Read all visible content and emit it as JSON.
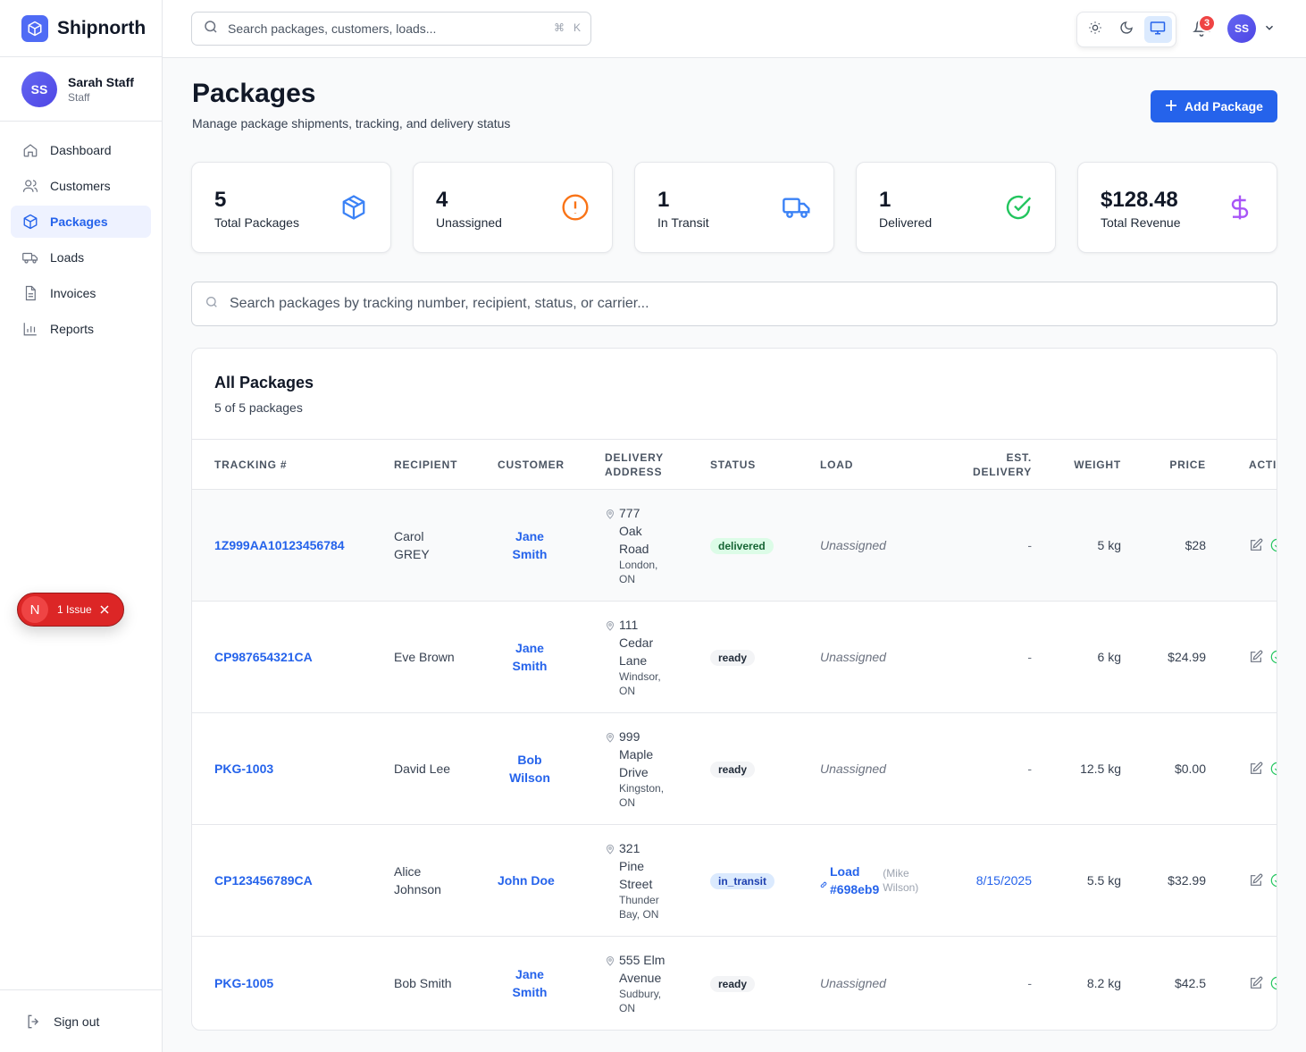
{
  "brand": {
    "name": "Shipnorth"
  },
  "user": {
    "initials": "SS",
    "name": "Sarah Staff",
    "role": "Staff"
  },
  "nav": [
    {
      "label": "Dashboard",
      "icon": "home-icon"
    },
    {
      "label": "Customers",
      "icon": "users-icon"
    },
    {
      "label": "Packages",
      "icon": "package-icon",
      "active": true
    },
    {
      "label": "Loads",
      "icon": "truck-icon"
    },
    {
      "label": "Invoices",
      "icon": "file-icon"
    },
    {
      "label": "Reports",
      "icon": "bar-chart-icon"
    }
  ],
  "signout_label": "Sign out",
  "issue": {
    "letter": "N",
    "label": "1 Issue"
  },
  "topbar": {
    "search_placeholder": "Search packages, customers, loads...",
    "shortcut": [
      "⌘",
      "K"
    ],
    "notifications": "3",
    "avatar": "SS"
  },
  "header": {
    "title": "Packages",
    "subtitle": "Manage package shipments, tracking, and delivery status",
    "add_label": "Add Package"
  },
  "stats": [
    {
      "value": "5",
      "label": "Total Packages",
      "icon": "package-icon",
      "color": "#3b82f6"
    },
    {
      "value": "4",
      "label": "Unassigned",
      "icon": "alert-circle-icon",
      "color": "#f97316"
    },
    {
      "value": "1",
      "label": "In Transit",
      "icon": "truck-icon",
      "color": "#3b82f6"
    },
    {
      "value": "1",
      "label": "Delivered",
      "icon": "check-circle-icon",
      "color": "#22c55e"
    },
    {
      "value": "$128.48",
      "label": "Total Revenue",
      "icon": "dollar-icon",
      "color": "#a855f7"
    }
  ],
  "package_search_placeholder": "Search packages by tracking number, recipient, status, or carrier...",
  "table": {
    "title": "All Packages",
    "subtitle": "5 of 5 packages",
    "headers": {
      "tracking": "TRACKING #",
      "recipient": "RECIPIENT",
      "customer": "CUSTOMER",
      "address": [
        "DELIVERY",
        "ADDRESS"
      ],
      "status": "STATUS",
      "load": "LOAD",
      "est": [
        "EST.",
        "DELIVERY"
      ],
      "weight": "WEIGHT",
      "price": "PRICE",
      "actions": "ACTIONS"
    },
    "rows": [
      {
        "tracking": "1Z999AA10123456784",
        "recipient": [
          "Carol",
          "GREY"
        ],
        "customer": [
          "Jane",
          "Smith"
        ],
        "street": [
          "777",
          "Oak",
          "Road"
        ],
        "city": [
          "London,",
          "ON"
        ],
        "status": "delivered",
        "load": "Unassigned",
        "est": "-",
        "weight": "5 kg",
        "price": "$28"
      },
      {
        "tracking": "CP987654321CA",
        "recipient": [
          "Eve Brown"
        ],
        "customer": [
          "Jane",
          "Smith"
        ],
        "street": [
          "111",
          "Cedar",
          "Lane"
        ],
        "city": [
          "Windsor,",
          "ON"
        ],
        "status": "ready",
        "load": "Unassigned",
        "est": "-",
        "weight": "6 kg",
        "price": "$24.99"
      },
      {
        "tracking": "PKG-1003",
        "recipient": [
          "David Lee"
        ],
        "customer": [
          "Bob",
          "Wilson"
        ],
        "street": [
          "999",
          "Maple",
          "Drive"
        ],
        "city": [
          "Kingston,",
          "ON"
        ],
        "status": "ready",
        "load": "Unassigned",
        "est": "-",
        "weight": "12.5 kg",
        "price": "$0.00"
      },
      {
        "tracking": "CP123456789CA",
        "recipient": [
          "Alice",
          "Johnson"
        ],
        "customer": [
          "John Doe"
        ],
        "street": [
          "321",
          "Pine",
          "Street"
        ],
        "city": [
          "Thunder",
          "Bay, ON"
        ],
        "status": "in_transit",
        "load": [
          "Load",
          "#698eb9"
        ],
        "driver": [
          "(Mike",
          "Wilson)"
        ],
        "est": "8/15/2025",
        "weight": "5.5 kg",
        "price": "$32.99"
      },
      {
        "tracking": "PKG-1005",
        "recipient": [
          "Bob Smith"
        ],
        "customer": [
          "Jane",
          "Smith"
        ],
        "street": [
          "555 Elm",
          "Avenue"
        ],
        "city": [
          "Sudbury,",
          "ON"
        ],
        "status": "ready",
        "load": "Unassigned",
        "est": "-",
        "weight": "8.2 kg",
        "price": "$42.5"
      }
    ]
  }
}
